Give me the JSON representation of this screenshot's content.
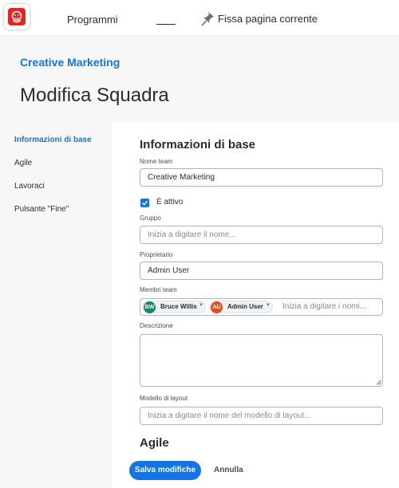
{
  "topbar": {
    "programs_label": "Programmi",
    "pin_label": "Fissa pagina corrente"
  },
  "header": {
    "breadcrumb": "Creative Marketing",
    "title": "Modifica Squadra"
  },
  "sidebar": {
    "items": [
      {
        "label": "Informazioni di base",
        "active": true
      },
      {
        "label": "Agile",
        "active": false
      },
      {
        "label": "Lavoraci",
        "active": false
      },
      {
        "label": "Pulsante \"Fine\"",
        "active": false
      }
    ]
  },
  "form": {
    "section_title": "Informazioni di base",
    "team_name": {
      "label": "Nome team",
      "value": "Creative Marketing"
    },
    "active": {
      "label": "È attivo",
      "checked": true
    },
    "group": {
      "label": "Gruppo",
      "placeholder": "Inizia a digitare il nome..."
    },
    "owner": {
      "label": "Proprietario",
      "value": "Admin User"
    },
    "members": {
      "label": "Membri team",
      "chips": [
        {
          "initials": "BW",
          "name": "Bruce Willis",
          "color": "#138a6a"
        },
        {
          "initials": "AU",
          "name": "Admin User",
          "color": "#e2501c"
        }
      ],
      "placeholder": "Inizia a digitare i nomi..."
    },
    "description": {
      "label": "Descrizione",
      "value": ""
    },
    "layout_template": {
      "label": "Modello di layout",
      "placeholder": "Inizia a digitare il nome del modello di layout..."
    },
    "next_section_title": "Agile"
  },
  "footer": {
    "save_label": "Salva modifiche",
    "cancel_label": "Annulla"
  },
  "colors": {
    "accent": "#1473e6",
    "logo": "#e8231f",
    "panel_bg": "#f7f7f7"
  },
  "icons": [
    "app-logo-icon",
    "pin-icon",
    "checkmark-icon",
    "chevron-down-icon",
    "resize-handle-icon"
  ]
}
